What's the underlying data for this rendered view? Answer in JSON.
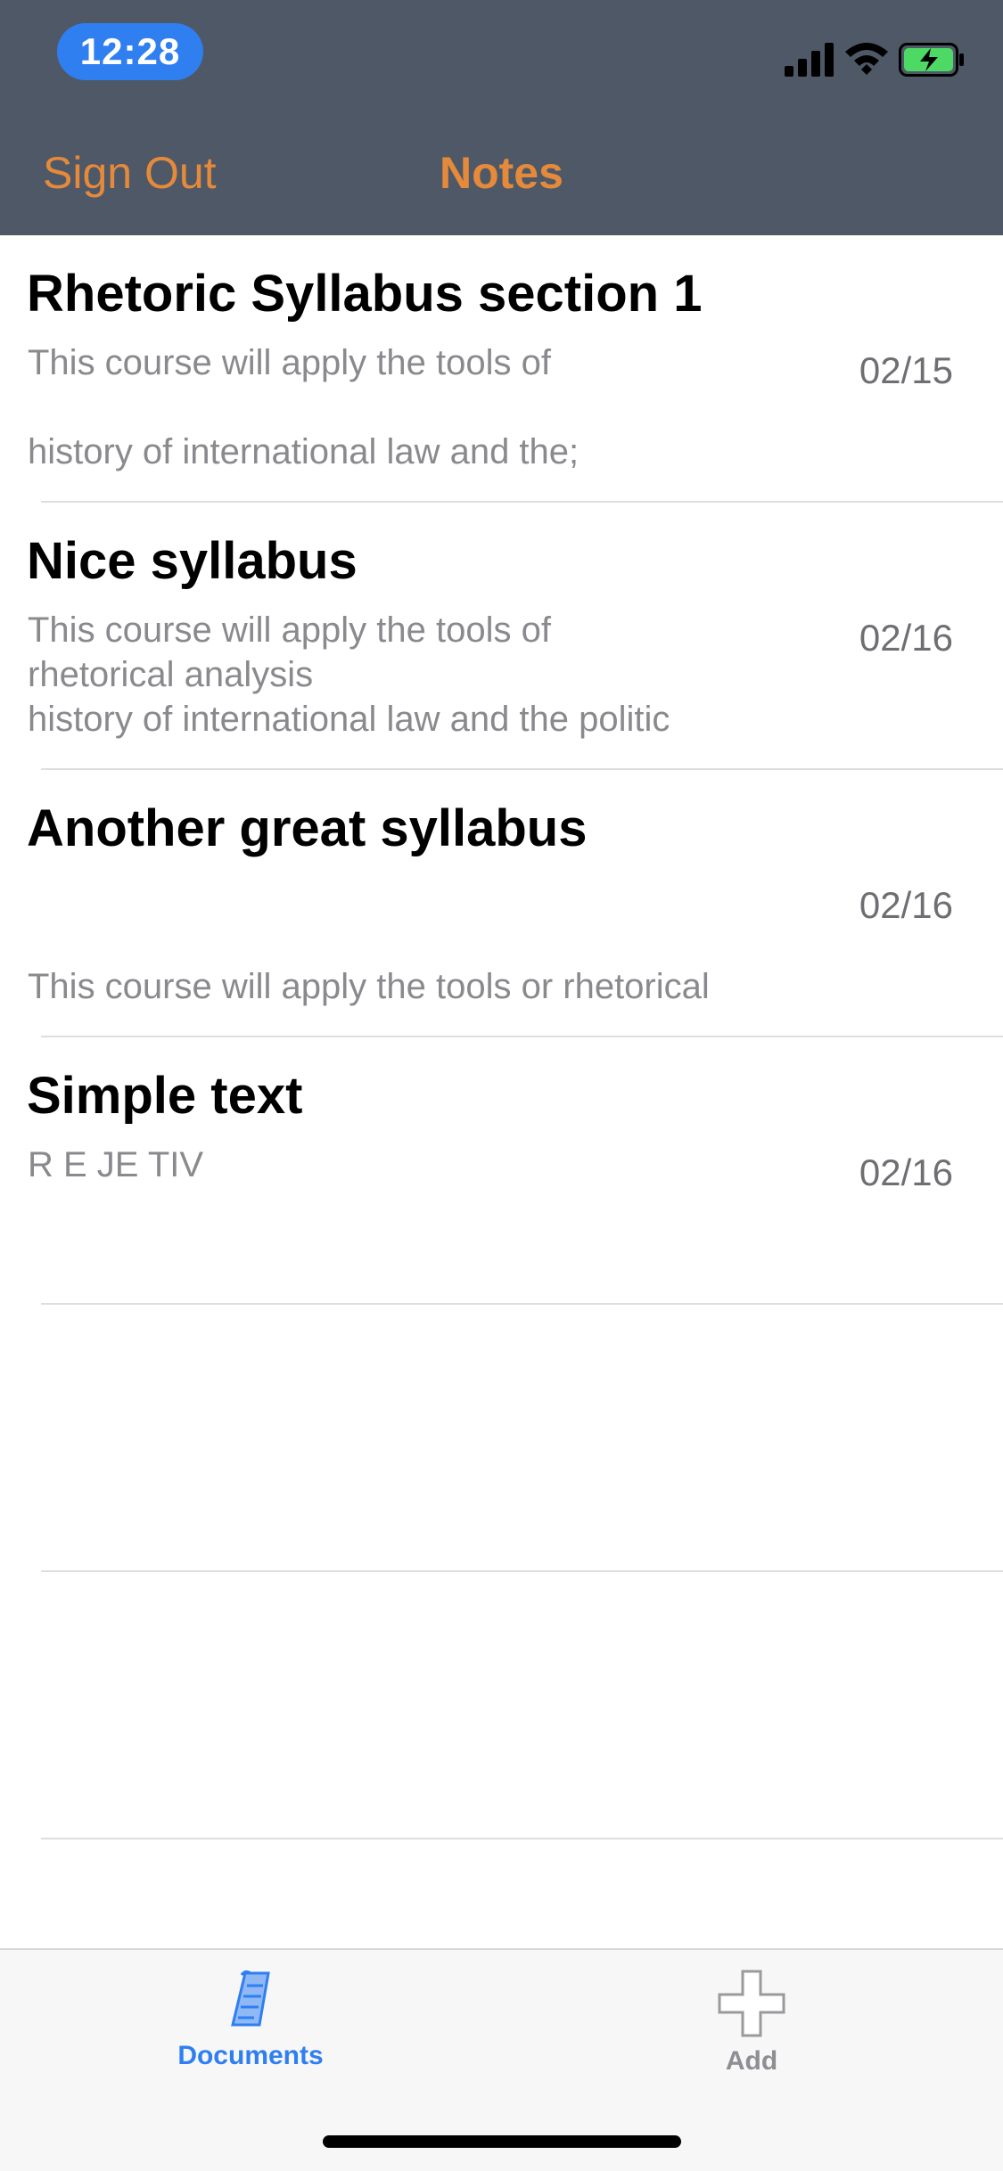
{
  "status_bar": {
    "time": "12:28",
    "icons": [
      "cellular-signal-icon",
      "wifi-icon",
      "battery-charging-icon"
    ]
  },
  "nav_bar": {
    "left_button": "Sign Out",
    "title": "Notes"
  },
  "notes": [
    {
      "title": "Rhetoric Syllabus section 1",
      "preview": "This course will apply the tools of\n\nhistory of international law and the;",
      "date": "02/15"
    },
    {
      "title": "Nice syllabus",
      "preview": "This course will apply the tools of\nrhetorical analysis\nhistory of international law and the politic",
      "date": "02/16"
    },
    {
      "title": "Another great syllabus",
      "preview": "\n\nThis course will apply the tools or rhetorical",
      "date": "02/16"
    },
    {
      "title": "Simple text",
      "preview": "R E JE TIV",
      "date": "02/16"
    }
  ],
  "tab_bar": {
    "documents_label": "Documents",
    "add_label": "Add",
    "selected": "Documents",
    "icons": [
      "documents-icon",
      "add-icon"
    ]
  },
  "colors": {
    "header_bg": "#4f5866",
    "accent_orange": "#e58a3b",
    "tab_active_blue": "#2f7ff1",
    "battery_green": "#4cd964"
  }
}
